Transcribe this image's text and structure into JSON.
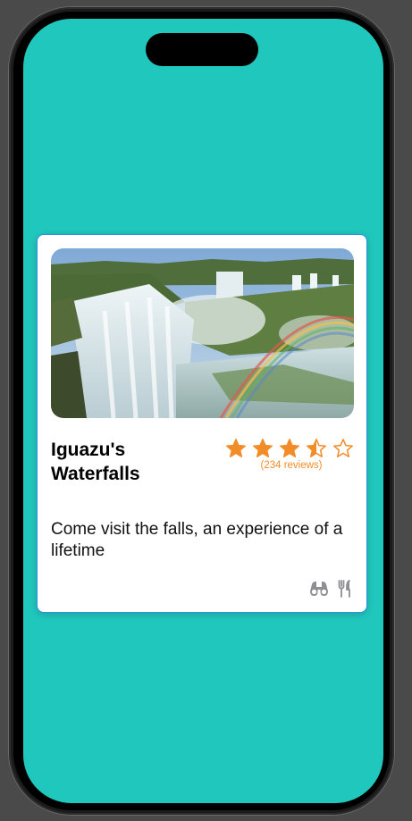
{
  "card": {
    "title": "Iguazu's Waterfalls",
    "rating": 3.5,
    "rating_max": 5,
    "reviews_label": "(234 reviews)",
    "description": "Come visit the falls, an experience of a lifetime",
    "image_icon": "waterfall-photo",
    "amenities": [
      {
        "icon": "binoculars-icon"
      },
      {
        "icon": "fork-knife-icon"
      }
    ]
  },
  "colors": {
    "screen_background": "#20c7bd",
    "accent_star": "#f28c28",
    "card_border": "#2f8fe0",
    "amenity_icon": "#8e8e93"
  }
}
